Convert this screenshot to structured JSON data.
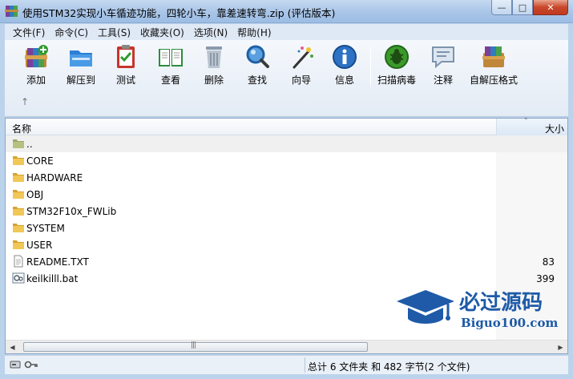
{
  "window": {
    "title": "使用STM32实现小车循迹功能，四轮小车，靠差速转弯.zip (评估版本)",
    "min_label": "—",
    "max_label": "□",
    "close_label": "✕"
  },
  "menu": [
    "文件(F)",
    "命令(C)",
    "工具(S)",
    "收藏夹(O)",
    "选项(N)",
    "帮助(H)"
  ],
  "toolbar": {
    "buttons": [
      {
        "label": "添加",
        "icon": "add-archive-icon"
      },
      {
        "label": "解压到",
        "icon": "extract-folder-icon"
      },
      {
        "label": "测试",
        "icon": "test-clipboard-icon"
      },
      {
        "label": "查看",
        "icon": "view-book-icon"
      },
      {
        "label": "删除",
        "icon": "trash-icon"
      },
      {
        "label": "查找",
        "icon": "magnifier-icon"
      },
      {
        "label": "向导",
        "icon": "wizard-wand-icon"
      },
      {
        "label": "信息",
        "icon": "info-icon"
      },
      {
        "label": "扫描病毒",
        "icon": "virus-scan-icon"
      },
      {
        "label": "注释",
        "icon": "comment-icon"
      },
      {
        "label": "自解压格式",
        "icon": "sfx-archive-icon"
      }
    ],
    "up_label": "↑"
  },
  "list": {
    "col_name": "名称",
    "col_size": "大小",
    "sort_indicator": "˄",
    "rows": [
      {
        "name": "..",
        "size": "",
        "type": "parent"
      },
      {
        "name": "CORE",
        "size": "",
        "type": "folder"
      },
      {
        "name": "HARDWARE",
        "size": "",
        "type": "folder"
      },
      {
        "name": "OBJ",
        "size": "",
        "type": "folder"
      },
      {
        "name": "STM32F10x_FWLib",
        "size": "",
        "type": "folder"
      },
      {
        "name": "SYSTEM",
        "size": "",
        "type": "folder"
      },
      {
        "name": "USER",
        "size": "",
        "type": "folder"
      },
      {
        "name": "README.TXT",
        "size": "83",
        "type": "text"
      },
      {
        "name": "keilkilll.bat",
        "size": "399",
        "type": "bat"
      }
    ]
  },
  "watermark": {
    "title": "必过源码",
    "site": "Biguo100.com"
  },
  "status": {
    "text": "总计 6 文件夹 和 482 字节(2 个文件)"
  },
  "colors": {
    "accent": "#1e5aa8",
    "folder": "#e8b73a",
    "close": "#c9472a"
  }
}
